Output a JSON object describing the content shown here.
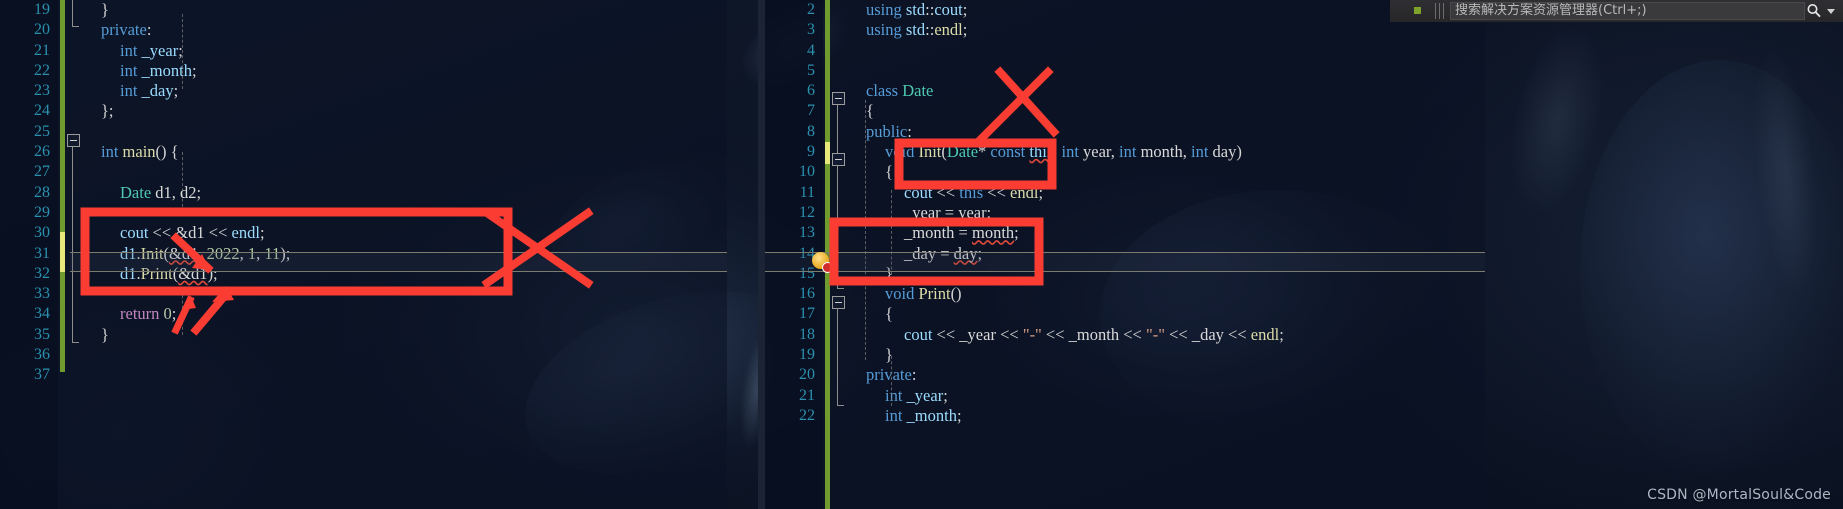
{
  "app": {
    "name": "Visual Studio code editor",
    "watermark": "CSDN @MortalSoul&Code"
  },
  "solution_explorer": {
    "search_placeholder": "搜索解决方案资源管理器(Ctrl+;)",
    "search_value": "",
    "search_icon": "magnifier-icon",
    "dropdown_icon": "chevron-down-icon"
  },
  "editor_left": {
    "first_line_number": 19,
    "line_numbers": [
      "19",
      "20",
      "21",
      "22",
      "23",
      "24",
      "25",
      "26",
      "27",
      "28",
      "29",
      "30",
      "31",
      "32",
      "33",
      "34",
      "35",
      "36",
      "37"
    ],
    "lines": [
      {
        "n": "19",
        "indent": 1,
        "tokens": [
          {
            "t": "}",
            "c": "pun"
          }
        ]
      },
      {
        "n": "20",
        "indent": 1,
        "tokens": [
          {
            "t": "private",
            "c": "kw"
          },
          {
            "t": ":",
            "c": "pun"
          }
        ]
      },
      {
        "n": "21",
        "indent": 2,
        "tokens": [
          {
            "t": "int",
            "c": "kw"
          },
          {
            "t": " ",
            "c": "pun"
          },
          {
            "t": "_year",
            "c": "var"
          },
          {
            "t": ";",
            "c": "pun"
          }
        ]
      },
      {
        "n": "22",
        "indent": 2,
        "tokens": [
          {
            "t": "int",
            "c": "kw"
          },
          {
            "t": " ",
            "c": "pun"
          },
          {
            "t": "_month",
            "c": "var"
          },
          {
            "t": ";",
            "c": "pun"
          }
        ]
      },
      {
        "n": "23",
        "indent": 2,
        "tokens": [
          {
            "t": "int",
            "c": "kw"
          },
          {
            "t": " ",
            "c": "pun"
          },
          {
            "t": "_day",
            "c": "var"
          },
          {
            "t": ";",
            "c": "pun"
          }
        ]
      },
      {
        "n": "24",
        "indent": 1,
        "tokens": [
          {
            "t": "};",
            "c": "pun"
          }
        ]
      },
      {
        "n": "25",
        "indent": 0,
        "tokens": []
      },
      {
        "n": "26",
        "indent": 1,
        "tokens": [
          {
            "t": "int",
            "c": "kw"
          },
          {
            "t": " ",
            "c": "pun"
          },
          {
            "t": "main",
            "c": "fn"
          },
          {
            "t": "() {",
            "c": "pun"
          }
        ]
      },
      {
        "n": "27",
        "indent": 0,
        "tokens": []
      },
      {
        "n": "28",
        "indent": 2,
        "tokens": [
          {
            "t": "Date",
            "c": "typ"
          },
          {
            "t": " ",
            "c": "pun"
          },
          {
            "t": "d1",
            "c": "mem"
          },
          {
            "t": ", ",
            "c": "pun"
          },
          {
            "t": "d2",
            "c": "mem"
          },
          {
            "t": ";",
            "c": "pun"
          }
        ]
      },
      {
        "n": "29",
        "indent": 0,
        "tokens": []
      },
      {
        "n": "30",
        "indent": 2,
        "tokens": [
          {
            "t": "cout",
            "c": "var"
          },
          {
            "t": " << ",
            "c": "op"
          },
          {
            "t": "&d1",
            "c": "mem"
          },
          {
            "t": " << ",
            "c": "op"
          },
          {
            "t": "endl",
            "c": "var"
          },
          {
            "t": ";",
            "c": "pun"
          }
        ]
      },
      {
        "n": "31",
        "indent": 2,
        "tokens": [
          {
            "t": "d1",
            "c": "var"
          },
          {
            "t": ".",
            "c": "pun"
          },
          {
            "t": "Init",
            "c": "fn"
          },
          {
            "t": "(",
            "c": "pun"
          },
          {
            "t": "&d1",
            "c": "mem err"
          },
          {
            "t": ", ",
            "c": "pun"
          },
          {
            "t": "2022",
            "c": "num"
          },
          {
            "t": ", ",
            "c": "pun"
          },
          {
            "t": "1",
            "c": "num"
          },
          {
            "t": ", ",
            "c": "pun"
          },
          {
            "t": "11",
            "c": "num"
          },
          {
            "t": ");",
            "c": "pun"
          }
        ]
      },
      {
        "n": "32",
        "indent": 2,
        "tokens": [
          {
            "t": "d1",
            "c": "var"
          },
          {
            "t": ".",
            "c": "pun"
          },
          {
            "t": "Print",
            "c": "fn"
          },
          {
            "t": "(",
            "c": "pun"
          },
          {
            "t": "&d1",
            "c": "mem err"
          },
          {
            "t": ");",
            "c": "pun"
          }
        ]
      },
      {
        "n": "33",
        "indent": 0,
        "tokens": []
      },
      {
        "n": "34",
        "indent": 2,
        "tokens": [
          {
            "t": "return",
            "c": "kw2"
          },
          {
            "t": " ",
            "c": "pun"
          },
          {
            "t": "0",
            "c": "num"
          },
          {
            "t": ";",
            "c": "pun"
          }
        ]
      },
      {
        "n": "35",
        "indent": 1,
        "tokens": [
          {
            "t": "}",
            "c": "pun"
          }
        ]
      },
      {
        "n": "36",
        "indent": 0,
        "tokens": []
      },
      {
        "n": "37",
        "indent": 0,
        "tokens": []
      }
    ],
    "modified_line": "31",
    "highlighted_line": "32"
  },
  "editor_right": {
    "first_line_number": 2,
    "line_numbers": [
      "2",
      "3",
      "4",
      "5",
      "6",
      "7",
      "8",
      "9",
      "10",
      "11",
      "12",
      "13",
      "14",
      "15",
      "16",
      "17",
      "18",
      "19",
      "20",
      "21",
      "22"
    ],
    "lines": [
      {
        "n": "2",
        "indent": 1,
        "tokens": [
          {
            "t": "using",
            "c": "kw"
          },
          {
            "t": " ",
            "c": "pun"
          },
          {
            "t": "std",
            "c": "var"
          },
          {
            "t": "::",
            "c": "pun"
          },
          {
            "t": "cout",
            "c": "var"
          },
          {
            "t": ";",
            "c": "pun"
          }
        ]
      },
      {
        "n": "3",
        "indent": 1,
        "tokens": [
          {
            "t": "using",
            "c": "kw"
          },
          {
            "t": " ",
            "c": "pun"
          },
          {
            "t": "std",
            "c": "var"
          },
          {
            "t": "::",
            "c": "pun"
          },
          {
            "t": "endl",
            "c": "fn"
          },
          {
            "t": ";",
            "c": "pun"
          }
        ]
      },
      {
        "n": "4",
        "indent": 0,
        "tokens": []
      },
      {
        "n": "5",
        "indent": 0,
        "tokens": []
      },
      {
        "n": "6",
        "indent": 1,
        "tokens": [
          {
            "t": "class",
            "c": "kw"
          },
          {
            "t": " ",
            "c": "pun"
          },
          {
            "t": "Date",
            "c": "typ"
          }
        ]
      },
      {
        "n": "7",
        "indent": 1,
        "tokens": [
          {
            "t": "{",
            "c": "pun"
          }
        ]
      },
      {
        "n": "8",
        "indent": 1,
        "tokens": [
          {
            "t": "public",
            "c": "kw"
          },
          {
            "t": ":",
            "c": "pun"
          }
        ]
      },
      {
        "n": "9",
        "indent": 2,
        "tokens": [
          {
            "t": "void",
            "c": "kw"
          },
          {
            "t": " ",
            "c": "pun"
          },
          {
            "t": "Init",
            "c": "fn"
          },
          {
            "t": "(",
            "c": "pun"
          },
          {
            "t": "Date",
            "c": "typ"
          },
          {
            "t": "* ",
            "c": "pun"
          },
          {
            "t": "const",
            "c": "kw"
          },
          {
            "t": " ",
            "c": "pun"
          },
          {
            "t": "this",
            "c": "var err"
          },
          {
            "t": ", ",
            "c": "pun"
          },
          {
            "t": "int",
            "c": "kw"
          },
          {
            "t": " ",
            "c": "pun"
          },
          {
            "t": "year",
            "c": "mem"
          },
          {
            "t": ", ",
            "c": "pun"
          },
          {
            "t": "int",
            "c": "kw"
          },
          {
            "t": " ",
            "c": "pun"
          },
          {
            "t": "month",
            "c": "mem"
          },
          {
            "t": ", ",
            "c": "pun"
          },
          {
            "t": "int",
            "c": "kw"
          },
          {
            "t": " ",
            "c": "pun"
          },
          {
            "t": "day",
            "c": "mem"
          },
          {
            "t": ")",
            "c": "pun"
          }
        ]
      },
      {
        "n": "10",
        "indent": 2,
        "tokens": [
          {
            "t": "{",
            "c": "pun"
          }
        ]
      },
      {
        "n": "11",
        "indent": 3,
        "tokens": [
          {
            "t": "cout",
            "c": "var"
          },
          {
            "t": " << ",
            "c": "op"
          },
          {
            "t": "this",
            "c": "kw"
          },
          {
            "t": " << ",
            "c": "op"
          },
          {
            "t": "endl",
            "c": "fn"
          },
          {
            "t": ";",
            "c": "pun"
          }
        ]
      },
      {
        "n": "12",
        "indent": 3,
        "tokens": [
          {
            "t": "_year",
            "c": "mem"
          },
          {
            "t": " = ",
            "c": "op"
          },
          {
            "t": "year",
            "c": "mem err"
          },
          {
            "t": ";",
            "c": "pun"
          }
        ]
      },
      {
        "n": "13",
        "indent": 3,
        "tokens": [
          {
            "t": "_month",
            "c": "mem"
          },
          {
            "t": " = ",
            "c": "op"
          },
          {
            "t": "month",
            "c": "mem err"
          },
          {
            "t": ";",
            "c": "pun"
          }
        ]
      },
      {
        "n": "14",
        "indent": 3,
        "tokens": [
          {
            "t": "_day",
            "c": "mem"
          },
          {
            "t": " = ",
            "c": "op"
          },
          {
            "t": "day",
            "c": "mem err"
          },
          {
            "t": ";",
            "c": "pun"
          }
        ]
      },
      {
        "n": "15",
        "indent": 2,
        "tokens": [
          {
            "t": "}",
            "c": "pun"
          }
        ]
      },
      {
        "n": "16",
        "indent": 2,
        "tokens": [
          {
            "t": "void",
            "c": "kw"
          },
          {
            "t": " ",
            "c": "pun"
          },
          {
            "t": "Print",
            "c": "fn"
          },
          {
            "t": "()",
            "c": "pun"
          }
        ]
      },
      {
        "n": "17",
        "indent": 2,
        "tokens": [
          {
            "t": "{",
            "c": "pun"
          }
        ]
      },
      {
        "n": "18",
        "indent": 3,
        "tokens": [
          {
            "t": "cout",
            "c": "var"
          },
          {
            "t": " << ",
            "c": "op"
          },
          {
            "t": "_year",
            "c": "mem"
          },
          {
            "t": " << ",
            "c": "op"
          },
          {
            "t": "\"-\"",
            "c": "str"
          },
          {
            "t": " << ",
            "c": "op"
          },
          {
            "t": "_month",
            "c": "mem"
          },
          {
            "t": " << ",
            "c": "op"
          },
          {
            "t": "\"-\"",
            "c": "str"
          },
          {
            "t": " << ",
            "c": "op"
          },
          {
            "t": "_day",
            "c": "mem"
          },
          {
            "t": " << ",
            "c": "op"
          },
          {
            "t": "endl",
            "c": "fn"
          },
          {
            "t": ";",
            "c": "pun"
          }
        ]
      },
      {
        "n": "19",
        "indent": 2,
        "tokens": [
          {
            "t": "}",
            "c": "pun"
          }
        ]
      },
      {
        "n": "20",
        "indent": 1,
        "tokens": [
          {
            "t": "private",
            "c": "kw"
          },
          {
            "t": ":",
            "c": "pun"
          }
        ]
      },
      {
        "n": "21",
        "indent": 2,
        "tokens": [
          {
            "t": "int",
            "c": "kw"
          },
          {
            "t": " ",
            "c": "pun"
          },
          {
            "t": "_year",
            "c": "var"
          },
          {
            "t": ";",
            "c": "pun"
          }
        ]
      },
      {
        "n": "22",
        "indent": 2,
        "tokens": [
          {
            "t": "int",
            "c": "kw"
          },
          {
            "t": " ",
            "c": "pun"
          },
          {
            "t": "_month",
            "c": "var"
          },
          {
            "t": ";",
            "c": "pun"
          }
        ]
      }
    ],
    "modified_line": "9",
    "error_line": "14"
  },
  "annotations": {
    "color": "#fa3c32",
    "items": [
      {
        "name": "rect-left-main-block",
        "kind": "rect",
        "note": "red box around cout/Init/Print calls in main"
      },
      {
        "name": "cross-left-block",
        "kind": "cross",
        "note": "red X crossing out the left boxed code"
      },
      {
        "name": "arrow-left-to-init",
        "kind": "arrow",
        "note": "arrow pointing at &d1 argument of Init"
      },
      {
        "name": "arrow-left-to-print",
        "kind": "arrow",
        "note": "arrow pointing at &d1 argument of Print"
      },
      {
        "name": "arrow-left-to-return",
        "kind": "arrow",
        "note": "arrow pointing up at the boxed region"
      },
      {
        "name": "rect-this-parameter",
        "kind": "rect",
        "note": "red box around (Date* const this,"
      },
      {
        "name": "cross-this-parameter",
        "kind": "cross",
        "note": "red X crossing out the hidden this parameter"
      },
      {
        "name": "rect-assignments",
        "kind": "rect",
        "note": "red box around _year/_month/_day assignments"
      }
    ]
  }
}
